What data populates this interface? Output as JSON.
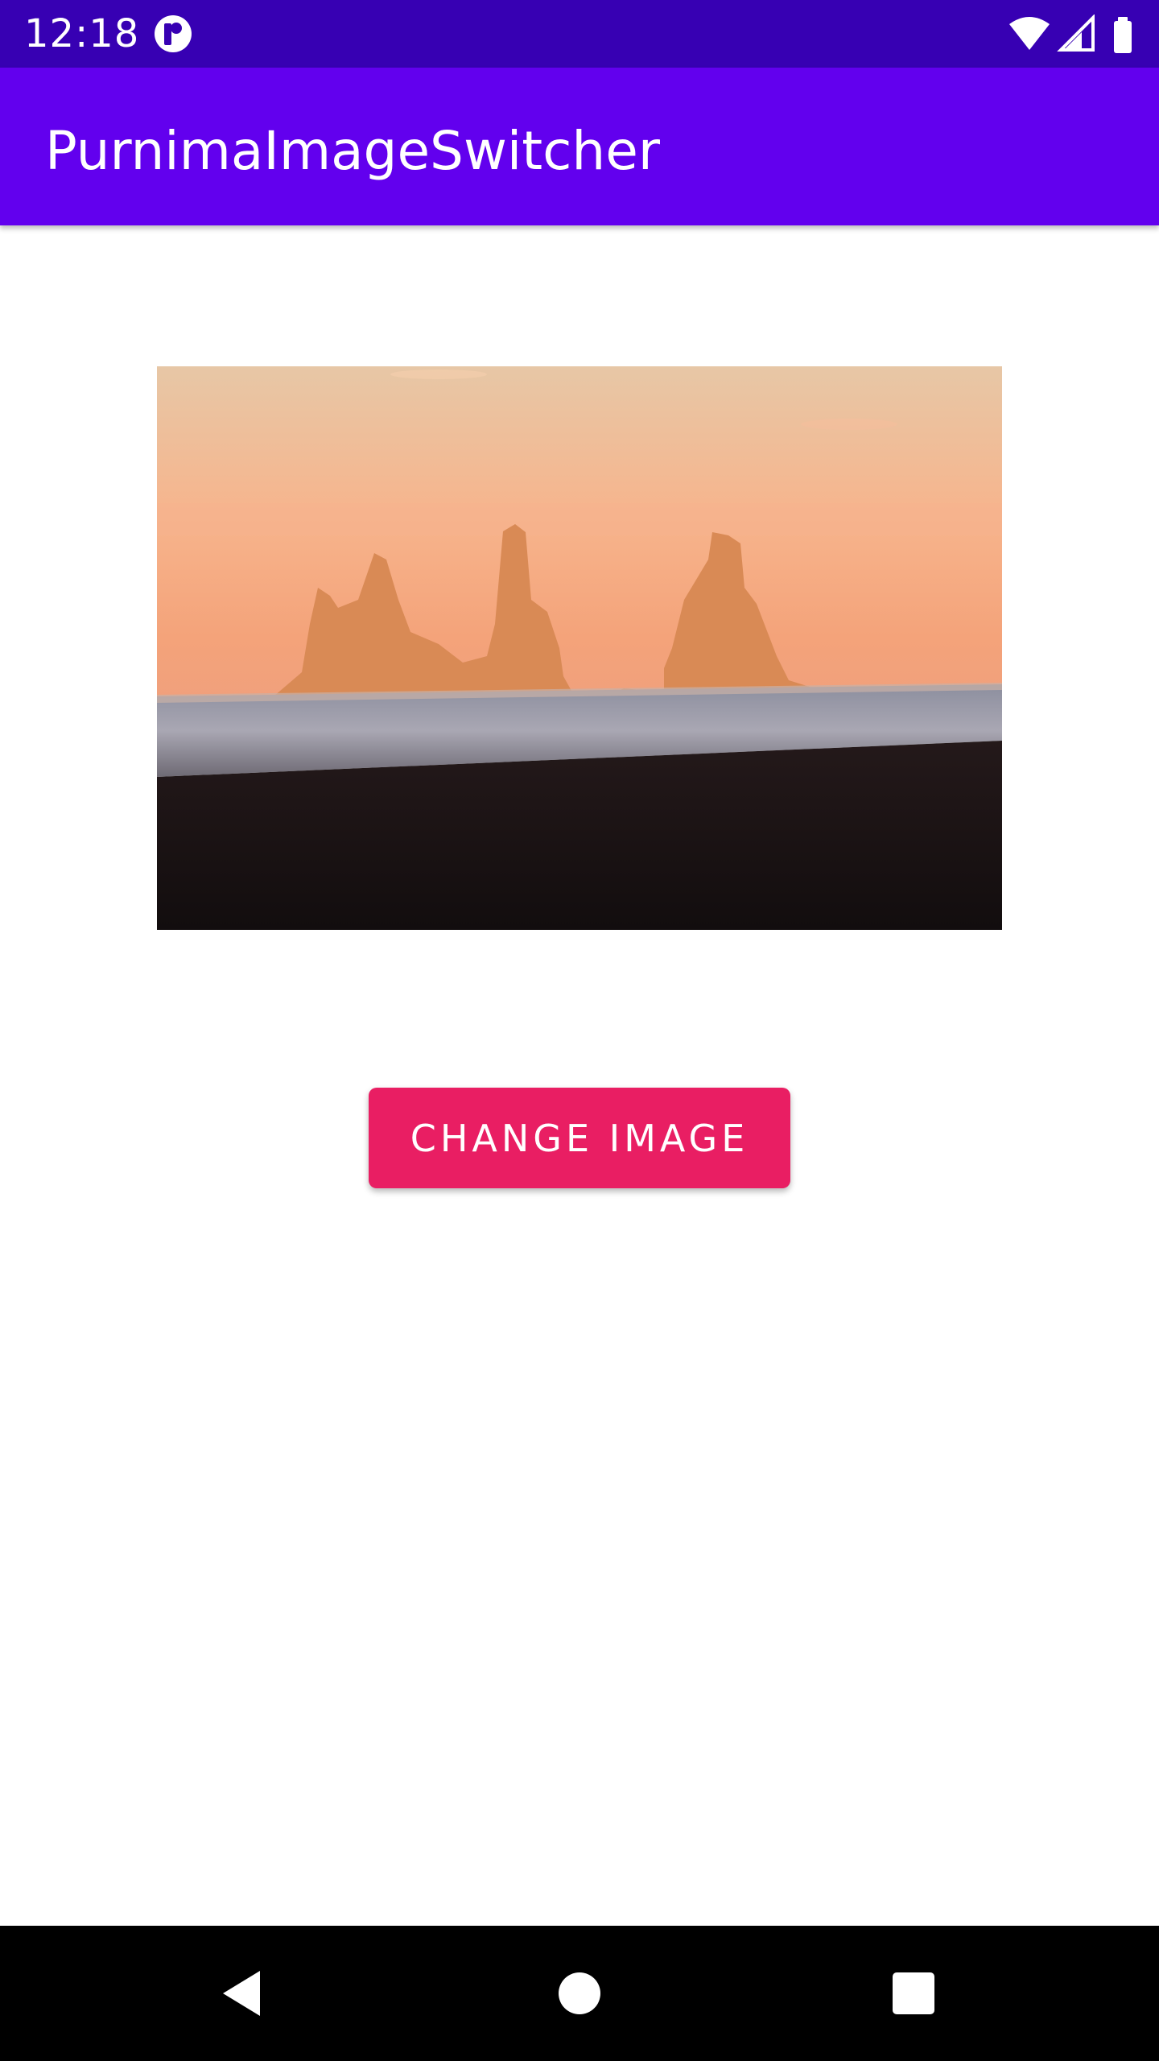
{
  "status_bar": {
    "time": "12:18",
    "icons": [
      "notification-app-icon",
      "wifi-icon",
      "signal-icon",
      "battery-icon"
    ],
    "background": "#3700B3"
  },
  "app_bar": {
    "title": "PurnimaImageSwitcher",
    "background": "#6200EE"
  },
  "main": {
    "image": {
      "subject": "sea stacks at sunset over ocean and black sand beach"
    },
    "change_button": {
      "label": "CHANGE IMAGE",
      "color": "#E91E63"
    }
  },
  "nav_bar": {
    "icons": [
      "back-icon",
      "home-icon",
      "recents-icon"
    ]
  }
}
